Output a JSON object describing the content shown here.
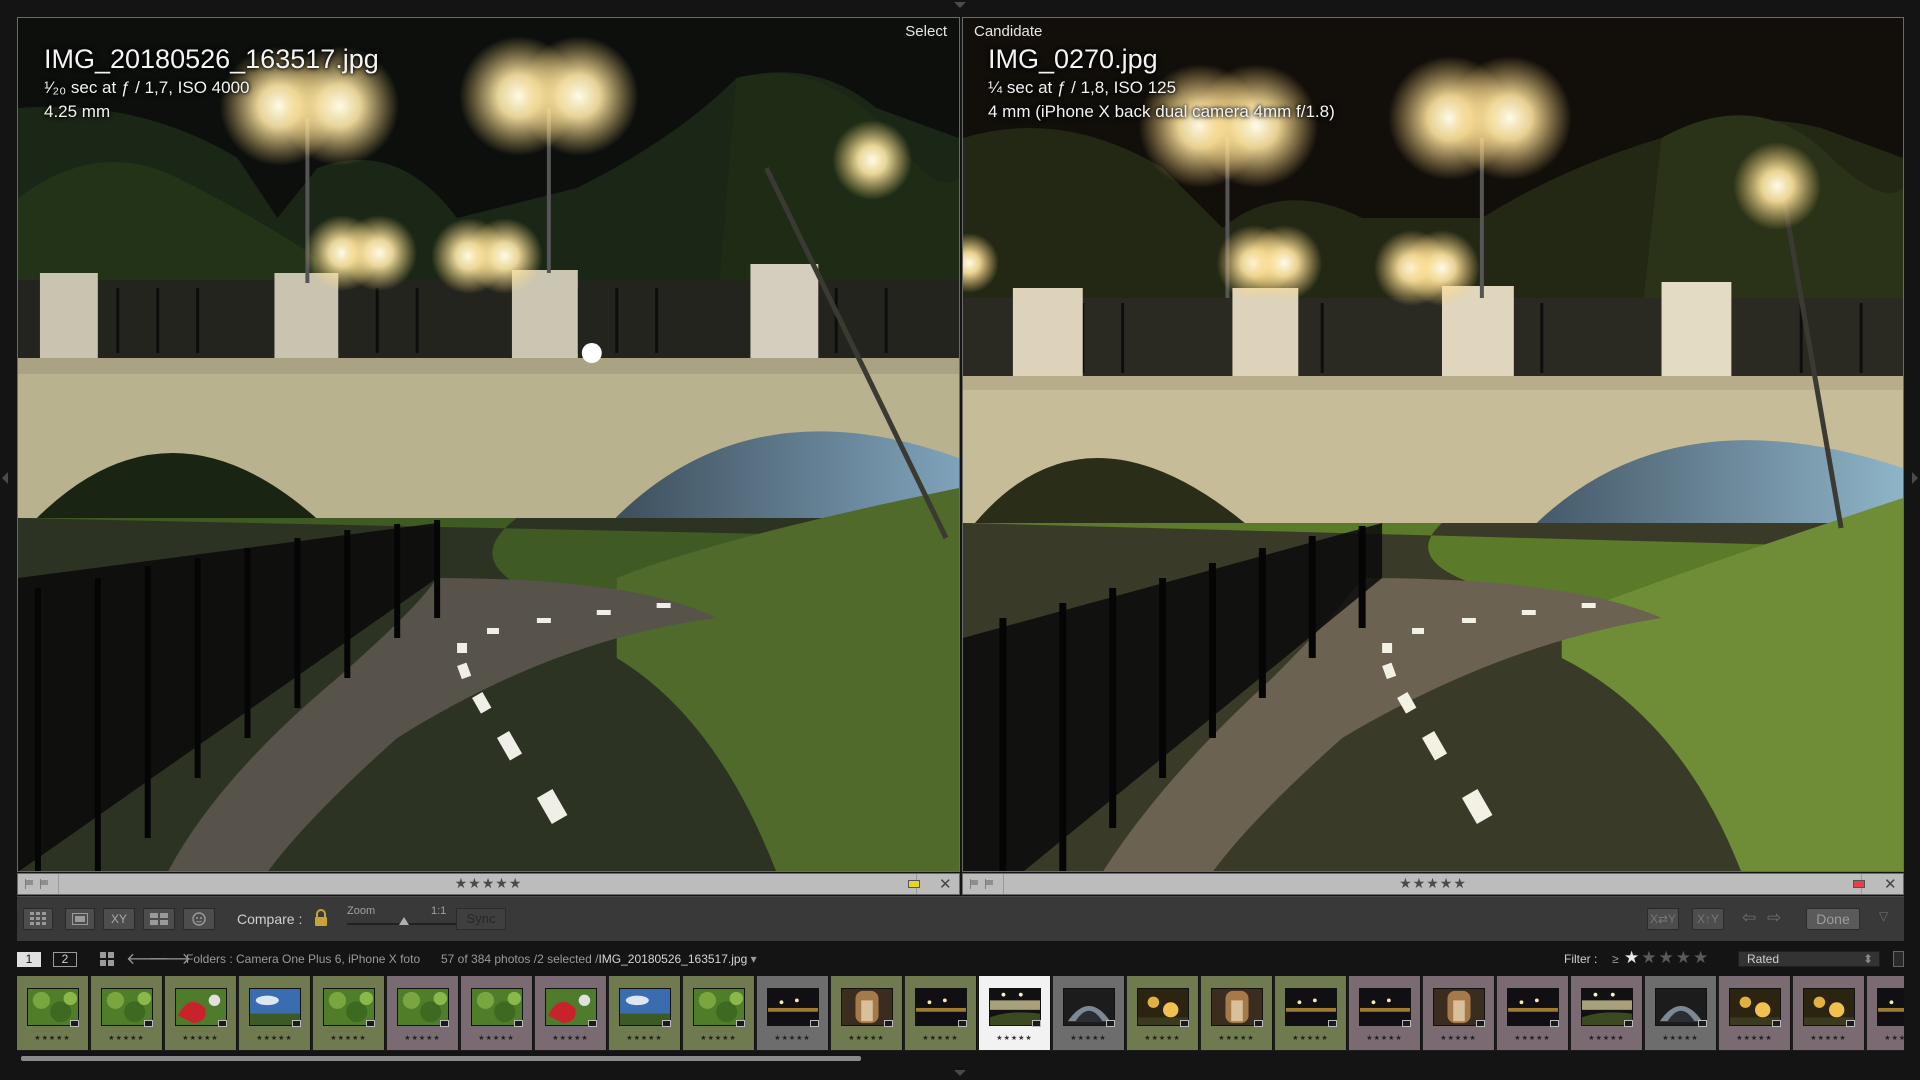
{
  "select_pane": {
    "tag": "Select",
    "file_name": "IMG_20180526_163517.jpg",
    "exposure": "¹⁄₂₀ sec at ƒ / 1,7, ISO 4000",
    "focal": "4.25 mm",
    "rating_stars": "★★★★★",
    "label_color": "#e3d52b"
  },
  "candidate_pane": {
    "tag": "Candidate",
    "file_name": "IMG_0270.jpg",
    "exposure": "¼ sec at ƒ / 1,8, ISO 125",
    "focal": "4 mm (iPhone X back dual camera 4mm f/1.8)",
    "rating_stars": "★★★★★",
    "label_color": "#e0444b"
  },
  "toolbar": {
    "compare_label": "Compare :",
    "zoom_label": "Zoom",
    "zoom_value": "1:1",
    "sync_label": "Sync",
    "xy_label": "XY",
    "done_label": "Done"
  },
  "filmstrip_header": {
    "screen1": "1",
    "screen2": "2",
    "folder_text": "Folders : Camera One Plus 6, iPhone X foto",
    "count_text": "57 of 384 photos /2 selected /",
    "current_file": "IMG_20180526_163517.jpg",
    "filter_label": "Filter :",
    "filter_op": "≥",
    "filter_stars": "★★★★★",
    "rated_option": "Rated"
  },
  "thumbnails": [
    {
      "bg": "#707a4f",
      "scene": "greenery",
      "stars": "★★★★★"
    },
    {
      "bg": "#707a4f",
      "scene": "greenery",
      "stars": "★★★★★"
    },
    {
      "bg": "#707a4f",
      "scene": "flower",
      "stars": "★★★★★"
    },
    {
      "bg": "#707a4f",
      "scene": "sky",
      "stars": "★★★★★"
    },
    {
      "bg": "#707a4f",
      "scene": "greenery",
      "stars": "★★★★★"
    },
    {
      "bg": "#7a6a72",
      "scene": "greenery",
      "stars": "★★★★★"
    },
    {
      "bg": "#7a6a72",
      "scene": "greenery",
      "stars": "★★★★★"
    },
    {
      "bg": "#7a6a72",
      "scene": "flower",
      "stars": "★★★★★"
    },
    {
      "bg": "#707a4f",
      "scene": "sky",
      "stars": "★★★★★"
    },
    {
      "bg": "#707a4f",
      "scene": "greenery",
      "stars": "★★★★★"
    },
    {
      "bg": "#6d6d6d",
      "scene": "night",
      "stars": "★★★★★"
    },
    {
      "bg": "#707a4f",
      "scene": "portrait",
      "stars": "★★★★★"
    },
    {
      "bg": "#707a4f",
      "scene": "night",
      "stars": "★★★★★"
    },
    {
      "bg": "#f2f2f2",
      "scene": "bridge",
      "stars": "★★★★★",
      "selected": true
    },
    {
      "bg": "#6d6d6d",
      "scene": "tunnel",
      "stars": "★★★★★"
    },
    {
      "bg": "#707a4f",
      "scene": "lights",
      "stars": "★★★★★"
    },
    {
      "bg": "#707a4f",
      "scene": "portrait",
      "stars": "★★★★★"
    },
    {
      "bg": "#707a4f",
      "scene": "night",
      "stars": "★★★★★"
    },
    {
      "bg": "#7a6a72",
      "scene": "night",
      "stars": "★★★★★"
    },
    {
      "bg": "#7a6a72",
      "scene": "portrait",
      "stars": "★★★★★"
    },
    {
      "bg": "#7a6a72",
      "scene": "night",
      "stars": "★★★★★"
    },
    {
      "bg": "#7a6a72",
      "scene": "bridge",
      "stars": "★★★★★"
    },
    {
      "bg": "#6d6d6d",
      "scene": "tunnel",
      "stars": "★★★★★"
    },
    {
      "bg": "#7a6a72",
      "scene": "lights",
      "stars": "★★★★★"
    },
    {
      "bg": "#7a6a72",
      "scene": "lights",
      "stars": "★★★★★"
    },
    {
      "bg": "#7a6a72",
      "scene": "night",
      "stars": "★★★★★"
    }
  ]
}
